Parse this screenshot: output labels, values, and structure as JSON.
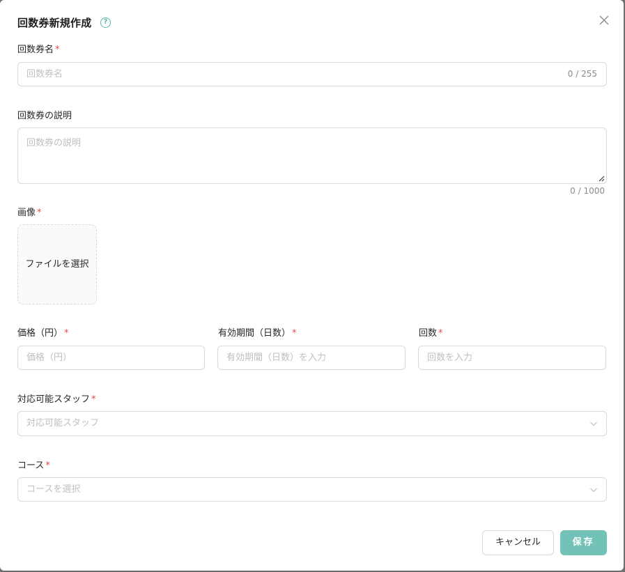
{
  "modal": {
    "title": "回数券新規作成",
    "help_icon": "question-circle-icon",
    "close_icon": "close-icon"
  },
  "form": {
    "name": {
      "label": "回数券名",
      "required": "*",
      "placeholder": "回数券名",
      "counter": "0 / 255"
    },
    "description": {
      "label": "回数券の説明",
      "placeholder": "回数券の説明",
      "counter": "0 / 1000"
    },
    "image": {
      "label": "画像",
      "required": "*",
      "upload_label": "ファイルを選択"
    },
    "price": {
      "label": "価格（円）",
      "required": "*",
      "placeholder": "価格（円）"
    },
    "validity": {
      "label": "有効期間（日数）",
      "required": "*",
      "placeholder": "有効期間（日数）を入力"
    },
    "count": {
      "label": "回数",
      "required": "*",
      "placeholder": "回数を入力"
    },
    "staff": {
      "label": "対応可能スタッフ",
      "required": "*",
      "placeholder": "対応可能スタッフ"
    },
    "course": {
      "label": "コース",
      "required": "*",
      "placeholder": "コースを選択"
    }
  },
  "footer": {
    "cancel_label": "キャンセル",
    "save_label": "保存"
  },
  "colors": {
    "accent": "#72c2b8",
    "required": "#e5484d",
    "border": "#d9d9d9",
    "placeholder": "#bfbfbf"
  }
}
